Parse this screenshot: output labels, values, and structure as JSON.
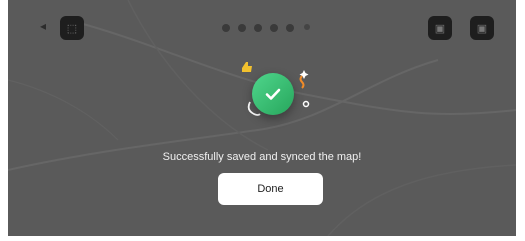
{
  "dialog": {
    "message": "Successfully saved and synced the map!",
    "done_label": "Done"
  },
  "icons": {
    "success": "check-circle-icon",
    "back": "back-arrow-icon",
    "top_left": "dark-square-button",
    "top_right_1": "dark-square-button",
    "top_right_2": "dark-square-button"
  },
  "colors": {
    "overlay": "#5a5a5a",
    "success_green": "#34b86e",
    "button_bg": "#ffffff"
  }
}
